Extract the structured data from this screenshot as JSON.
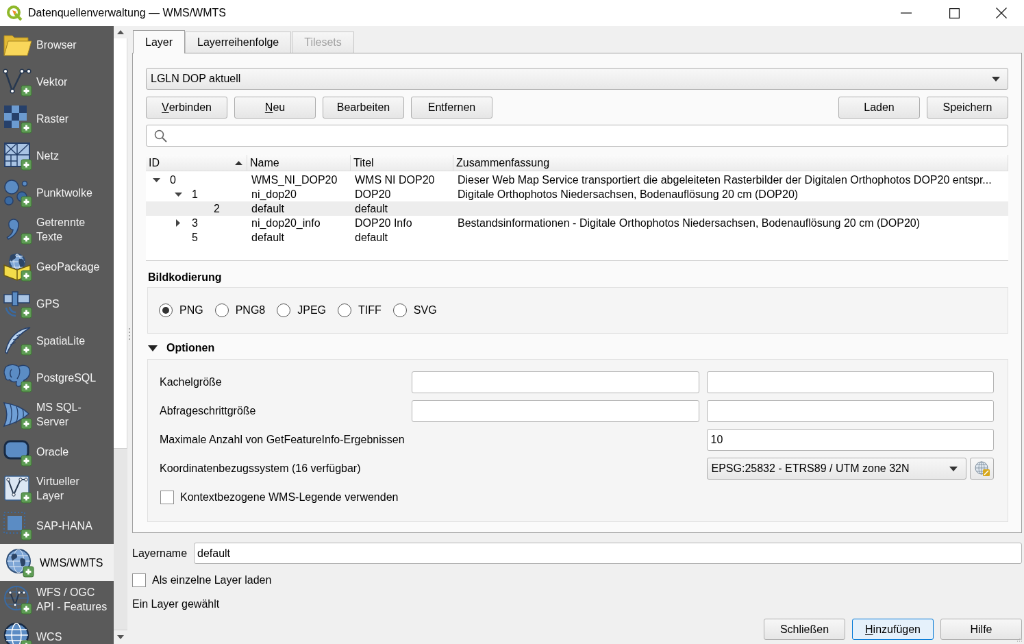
{
  "window": {
    "title": "Datenquellenverwaltung — WMS/WMTS"
  },
  "sidebar": {
    "items": [
      {
        "lines": [
          "Browser"
        ],
        "selected": false
      },
      {
        "lines": [
          "Vektor"
        ],
        "selected": false
      },
      {
        "lines": [
          "Raster"
        ],
        "selected": false
      },
      {
        "lines": [
          "Netz"
        ],
        "selected": false
      },
      {
        "lines": [
          "Punktwolke"
        ],
        "selected": false
      },
      {
        "lines": [
          "Getrennte",
          "Texte"
        ],
        "selected": false
      },
      {
        "lines": [
          "GeoPackage"
        ],
        "selected": false
      },
      {
        "lines": [
          "GPS"
        ],
        "selected": false
      },
      {
        "lines": [
          "SpatiaLite"
        ],
        "selected": false
      },
      {
        "lines": [
          "PostgreSQL"
        ],
        "selected": false
      },
      {
        "lines": [
          "MS SQL-",
          "Server"
        ],
        "selected": false
      },
      {
        "lines": [
          "Oracle"
        ],
        "selected": false
      },
      {
        "lines": [
          "Virtueller",
          "Layer"
        ],
        "selected": false
      },
      {
        "lines": [
          "SAP-HANA"
        ],
        "selected": false
      },
      {
        "lines": [
          "WMS/WMTS"
        ],
        "selected": true
      },
      {
        "lines": [
          "WFS / OGC",
          "API - Features"
        ],
        "selected": false
      },
      {
        "lines": [
          "WCS"
        ],
        "selected": false
      }
    ]
  },
  "tabs": [
    {
      "label": "Layer",
      "selected": true,
      "disabled": false
    },
    {
      "label": "Layerreihenfolge",
      "selected": false,
      "disabled": false
    },
    {
      "label": "Tilesets",
      "selected": false,
      "disabled": true
    }
  ],
  "connection": {
    "value": "LGLN DOP aktuell"
  },
  "connection_buttons": [
    {
      "label": "Verbinden",
      "mnemonic": true
    },
    {
      "label": "Neu",
      "mnemonic": true
    },
    {
      "label": "Bearbeiten",
      "mnemonic": false
    },
    {
      "label": "Entfernen",
      "mnemonic": false
    }
  ],
  "file_buttons": [
    {
      "label": "Laden",
      "mnemonic": false
    },
    {
      "label": "Speichern",
      "mnemonic": false
    }
  ],
  "layer_table": {
    "columns": [
      {
        "label": "ID",
        "sorted": true
      },
      {
        "label": "Name",
        "sorted": false
      },
      {
        "label": "Titel",
        "sorted": false
      },
      {
        "label": "Zusammenfassung",
        "sorted": false
      }
    ],
    "rows": [
      {
        "id": "0",
        "name": "WMS_NI_DOP20",
        "title": "WMS NI DOP20",
        "summary": "Dieser Web Map Service transportiert die abgeleiteten Rasterbilder der Digitalen Orthophotos DOP20 entspr...",
        "expanded": true,
        "selected": false,
        "children": [
          {
            "id": "1",
            "name": "ni_dop20",
            "title": "DOP20",
            "summary": "Digitale Orthophotos Niedersachsen, Bodenauflösung 20 cm (DOP20)",
            "expanded": true,
            "selected": false,
            "children": [
              {
                "id": "2",
                "name": "default",
                "title": "default",
                "selected": true
              }
            ]
          },
          {
            "id": "3",
            "name": "ni_dop20_info",
            "title": "DOP20 Info",
            "summary": "Bestandsinformationen - Digitale Orthophotos Niedersachsen, Bodenauflösung 20 cm (DOP20)",
            "expanded": false,
            "selected": false
          },
          {
            "id": "5",
            "name": "default",
            "title": "default",
            "selected": false
          }
        ]
      }
    ]
  },
  "image_encoding": {
    "title": "Bildkodierung",
    "options": [
      {
        "label": "PNG",
        "selected": true
      },
      {
        "label": "PNG8",
        "selected": false
      },
      {
        "label": "JPEG",
        "selected": false
      },
      {
        "label": "TIFF",
        "selected": false
      },
      {
        "label": "SVG",
        "selected": false
      }
    ]
  },
  "options": {
    "title": "Optionen",
    "expanded": true,
    "rows": [
      {
        "kind": "pair",
        "label": "Kachelgröße"
      },
      {
        "kind": "pair",
        "label": "Abfrageschrittgröße"
      },
      {
        "kind": "single",
        "label": "Maximale Anzahl von GetFeatureInfo-Ergebnissen",
        "value": "10"
      },
      {
        "kind": "crs",
        "label": "Koordinatenbezugssystem (16 verfügbar)",
        "value": "EPSG:25832 - ETRS89 / UTM zone 32N"
      },
      {
        "kind": "checkbox",
        "label": "Kontextbezogene WMS-Legende verwenden",
        "checked": false
      }
    ]
  },
  "layer_name": {
    "label": "Layername",
    "value": "default"
  },
  "load_separately": {
    "label": "Als einzelne Layer laden",
    "checked": false
  },
  "status": "Ein Layer gewählt",
  "dialog_buttons": [
    {
      "label": "Schließen",
      "mnemonic": false,
      "focused": false
    },
    {
      "label": "Hinzufügen",
      "mnemonic": true,
      "focused": true
    },
    {
      "label": "Hilfe",
      "mnemonic": false,
      "focused": false
    }
  ]
}
